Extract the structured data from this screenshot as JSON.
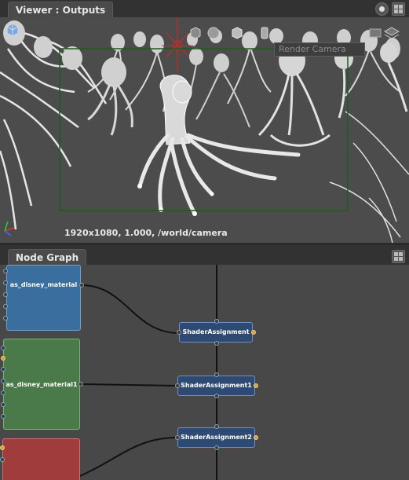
{
  "viewer": {
    "tab_label": "Viewer : Outputs",
    "camera_placeholder": "Render Camera",
    "resolution_text": "1920x1080, 1.000, /world/camera"
  },
  "node_graph": {
    "tab_label": "Node Graph",
    "material_nodes": [
      {
        "label": "as_disney_material",
        "color": "#3a6e9e"
      },
      {
        "label": "as_disney_material1",
        "color": "#4b7a4a"
      },
      {
        "label": "",
        "color": "#a03c3c"
      }
    ],
    "shader_nodes": [
      {
        "label": "ShaderAssignment"
      },
      {
        "label": "ShaderAssignment1"
      },
      {
        "label": "ShaderAssignment2"
      }
    ]
  },
  "icons": [
    "camera-icon",
    "cube-icon",
    "sphere-icon",
    "light-cube-icon",
    "target-icon",
    "grid-layout-icon",
    "folder-icon",
    "display-icon",
    "axis-gizmo-icon"
  ]
}
